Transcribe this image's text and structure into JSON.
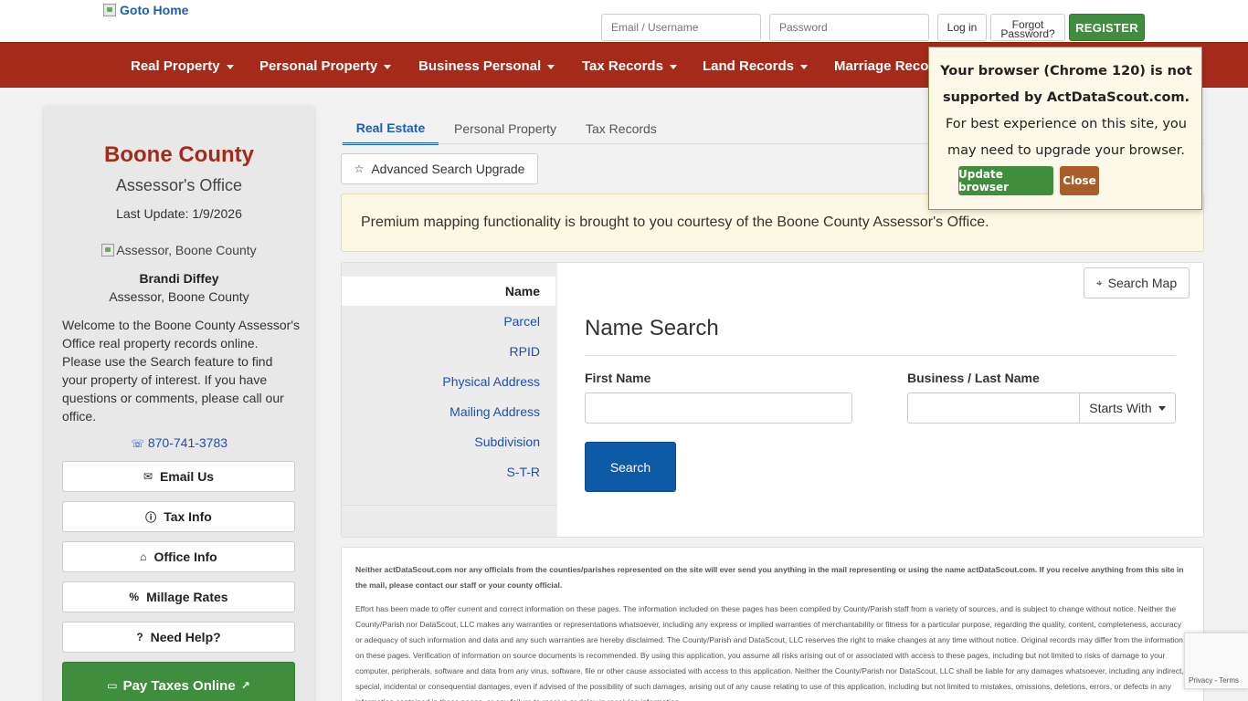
{
  "header": {
    "logo_alt": "Goto Home",
    "email_placeholder": "Email / Username",
    "password_placeholder": "Password",
    "login_label": "Log in",
    "forgot_line1": "Forgot",
    "forgot_line2": "Password?",
    "register_label": "REGISTER"
  },
  "nav": {
    "items": [
      {
        "label": "Real Property"
      },
      {
        "label": "Personal Property"
      },
      {
        "label": "Business Personal"
      },
      {
        "label": "Tax Records"
      },
      {
        "label": "Land Records"
      },
      {
        "label": "Marriage Reco"
      }
    ]
  },
  "sidebar": {
    "county": "Boone County",
    "office": "Assessor's Office",
    "last_update": "Last Update: 1/9/2026",
    "assessor_img_alt": "Assessor, Boone County",
    "assessor_name": "Brandi Diffey",
    "assessor_role": "Assessor, Boone County",
    "welcome": "Welcome to the Boone County Assessor's Office real property records online. Please use the Search feature to find your property of interest. If you have questions or comments, please call our office.",
    "phone": "870-741-3783",
    "buttons": [
      {
        "label": "Email Us",
        "icon": "envelope-icon"
      },
      {
        "label": "Tax Info",
        "icon": "info-icon"
      },
      {
        "label": "Office Info",
        "icon": "building-icon"
      },
      {
        "label": "Millage Rates",
        "icon": "percent-icon"
      },
      {
        "label": "Need Help?",
        "icon": "question-icon"
      }
    ],
    "pay_label": "Pay Taxes Online"
  },
  "tabs": [
    {
      "label": "Real Estate",
      "active": true
    },
    {
      "label": "Personal Property",
      "active": false
    },
    {
      "label": "Tax Records",
      "active": false
    }
  ],
  "advanced_search": "Advanced Search Upgrade",
  "premium_notice": "Premium mapping functionality is brought to you courtesy of the Boone County Assessor's Office.",
  "search": {
    "menu": [
      "Name",
      "Parcel",
      "RPID",
      "Physical Address",
      "Mailing Address",
      "Subdivision",
      "S-T-R"
    ],
    "search_map": "Search Map",
    "title": "Name Search",
    "first_name_label": "First Name",
    "last_name_label": "Business / Last Name",
    "starts_with": "Starts With",
    "search_button": "Search"
  },
  "disclaimer": {
    "bold": "Neither actDataScout.com nor any officials from the counties/parishes represented on the site will ever send you anything in the mail representing or using the name actDataScout.com. If you receive anything from this site in the mail, please contact our staff or your county official.",
    "text": "Effort has been made to offer current and correct information on these pages. The information included on these pages has been compiled by County/Parish staff from a variety of sources, and is subject to change without notice. Neither the County/Parish nor DataScout, LLC makes any warranties or representations whatsoever, including any express or implied warranties of merchantability or fitness for a particular purpose, regarding the quality, content, completeness, accuracy or adequacy of such information and data and any such warranties are hereby disclaimed. The County/Parish and DataScout, LLC reserves the right to make changes at any time without notice. Original records may differ from the information on these pages. Verification of information on source documents is recommended. By using this application, you assume all risks arising out of or associated with access to these pages, including but not limited to risks of damage to your computer, peripherals, software and data from any virus, software, file or other cause associated with access to this application. Neither the County/Parish nor DataScout, LLC shall be liable for any damages whatsoever, including any indirect, special, incidental or consequential damages, even if advised of the possibility of such damages, arising out of any cause relating to use of this application, including but not limited to mistakes, omissions, deletions, errors, or defects in any information contained in these pages, or any failure to receive or delay in receiving information."
  },
  "browser_popup": {
    "line1": "Your browser (Chrome 120) is not",
    "line2": "supported by ActDataScout.com.",
    "line3": "For best experience on this site, you",
    "line4": "may need to upgrade your browser.",
    "update_label": "Update browser",
    "close_label": "Close"
  },
  "recaptcha": {
    "privacy": "Privacy",
    "sep": "-",
    "terms": "Terms"
  }
}
